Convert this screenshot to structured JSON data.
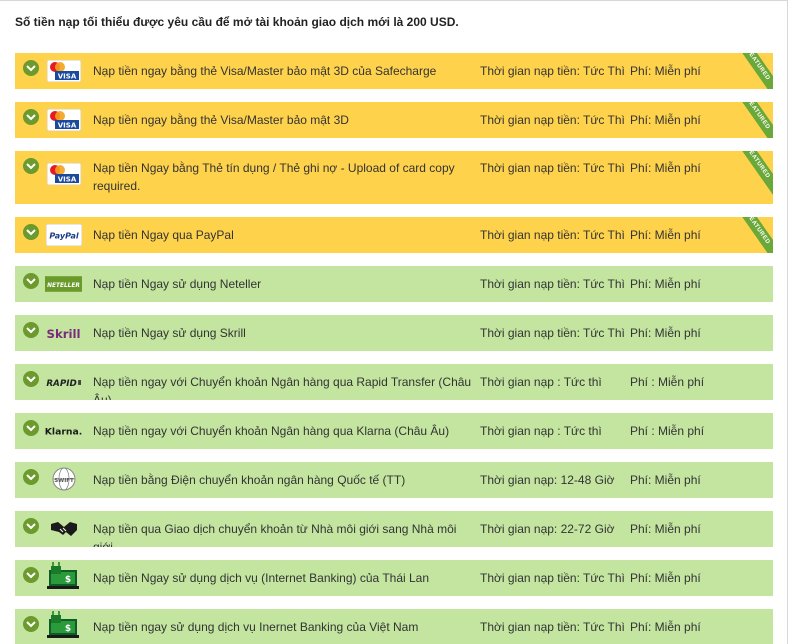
{
  "headline": "Số tiền nạp tối thiểu được yêu cầu để mở tài khoản giao dịch mới là 200 USD.",
  "featured_label": "FEATURED",
  "colors": {
    "yellow_row": "#ffd24c",
    "green_row": "#c3e5a0",
    "chevron": "#6c9a2c",
    "ribbon": "#6aa83a"
  },
  "methods": [
    {
      "logo": "visa-mastercard-icon",
      "logo_text": "VISA",
      "description": "Nạp tiền ngay bằng thẻ Visa/Master bảo mật 3D của Safecharge",
      "time": "Thời gian nạp tiền: Tức Thì",
      "fee": "Phí: Miễn phí",
      "featured": true,
      "color": "yellow"
    },
    {
      "logo": "visa-mastercard-icon",
      "logo_text": "VISA",
      "description": "Nạp tiền ngay bằng thẻ Visa/Master bảo mật 3D",
      "time": "Thời gian nạp tiền: Tức Thì",
      "fee": "Phí: Miễn phí",
      "featured": true,
      "color": "yellow"
    },
    {
      "logo": "visa-mastercard-icon",
      "logo_text": "VISA",
      "description": "Nạp tiền Ngay bằng Thẻ tín dụng / Thẻ ghi nợ - Upload of card copy required.",
      "time": "Thời gian nạp tiền: Tức Thì",
      "fee": "Phí: Miễn phí",
      "featured": true,
      "color": "yellow"
    },
    {
      "logo": "paypal-icon",
      "logo_text": "PayPal",
      "description": "Nạp tiền Ngay qua PayPal",
      "time": "Thời gian nạp tiền: Tức Thì",
      "fee": "Phí: Miễn phí",
      "featured": true,
      "color": "yellow"
    },
    {
      "logo": "neteller-icon",
      "logo_text": "NETELLER",
      "description": "Nạp tiền Ngay sử dụng Neteller",
      "time": "Thời gian nạp tiền: Tức Thì",
      "fee": "Phí: Miễn phí",
      "featured": false,
      "color": "green"
    },
    {
      "logo": "skrill-icon",
      "logo_text": "Skrill",
      "description": "Nạp tiền Ngay sử dụng Skrill",
      "time": "Thời gian nạp tiền: Tức Thì",
      "fee": "Phí: Miễn phí",
      "featured": false,
      "color": "green"
    },
    {
      "logo": "rapid-transfer-icon",
      "logo_text": "RAPID",
      "description": "Nạp tiền ngay với Chuyển khoản Ngân hàng qua Rapid Transfer (Châu Âu)",
      "time": "Thời gian nạp : Tức thì",
      "fee": "Phí : Miễn phí",
      "featured": false,
      "color": "green"
    },
    {
      "logo": "klarna-icon",
      "logo_text": "Klarna.",
      "description": "Nạp tiền ngay với Chuyển khoản Ngân hàng qua Klarna (Châu Âu)",
      "time": "Thời gian nạp : Tức thì",
      "fee": "Phí : Miễn phí",
      "featured": false,
      "color": "green"
    },
    {
      "logo": "swift-icon",
      "logo_text": "SWIFT",
      "description": "Nạp tiền bằng Điện chuyển khoản ngân hàng Quốc tế (TT)",
      "time": "Thời gian nạp: 12-48 Giờ",
      "fee": "Phí: Miễn phí",
      "featured": false,
      "color": "green"
    },
    {
      "logo": "handshake-icon",
      "logo_text": "",
      "description": "Nạp tiền qua Giao dịch chuyển khoản từ Nhà môi giới sang Nhà môi giới",
      "time": "Thời gian nạp: 22-72 Giờ",
      "fee": "Phí: Miễn phí",
      "featured": false,
      "color": "green"
    },
    {
      "logo": "internet-banking-icon",
      "logo_text": "",
      "description": "Nạp tiền Ngay sử dụng dịch vụ (Internet Banking) của Thái Lan",
      "time": "Thời gian nạp tiền: Tức Thì",
      "fee": "Phí: Miễn phí",
      "featured": false,
      "color": "green"
    },
    {
      "logo": "internet-banking-icon",
      "logo_text": "",
      "description": "Nạp tiền ngay sử dụng dịch vụ Inernet Banking của Việt Nam",
      "time": "Thời gian nạp tiền: Tức Thì",
      "fee": "Phí: Miễn phí",
      "featured": false,
      "color": "green"
    }
  ]
}
